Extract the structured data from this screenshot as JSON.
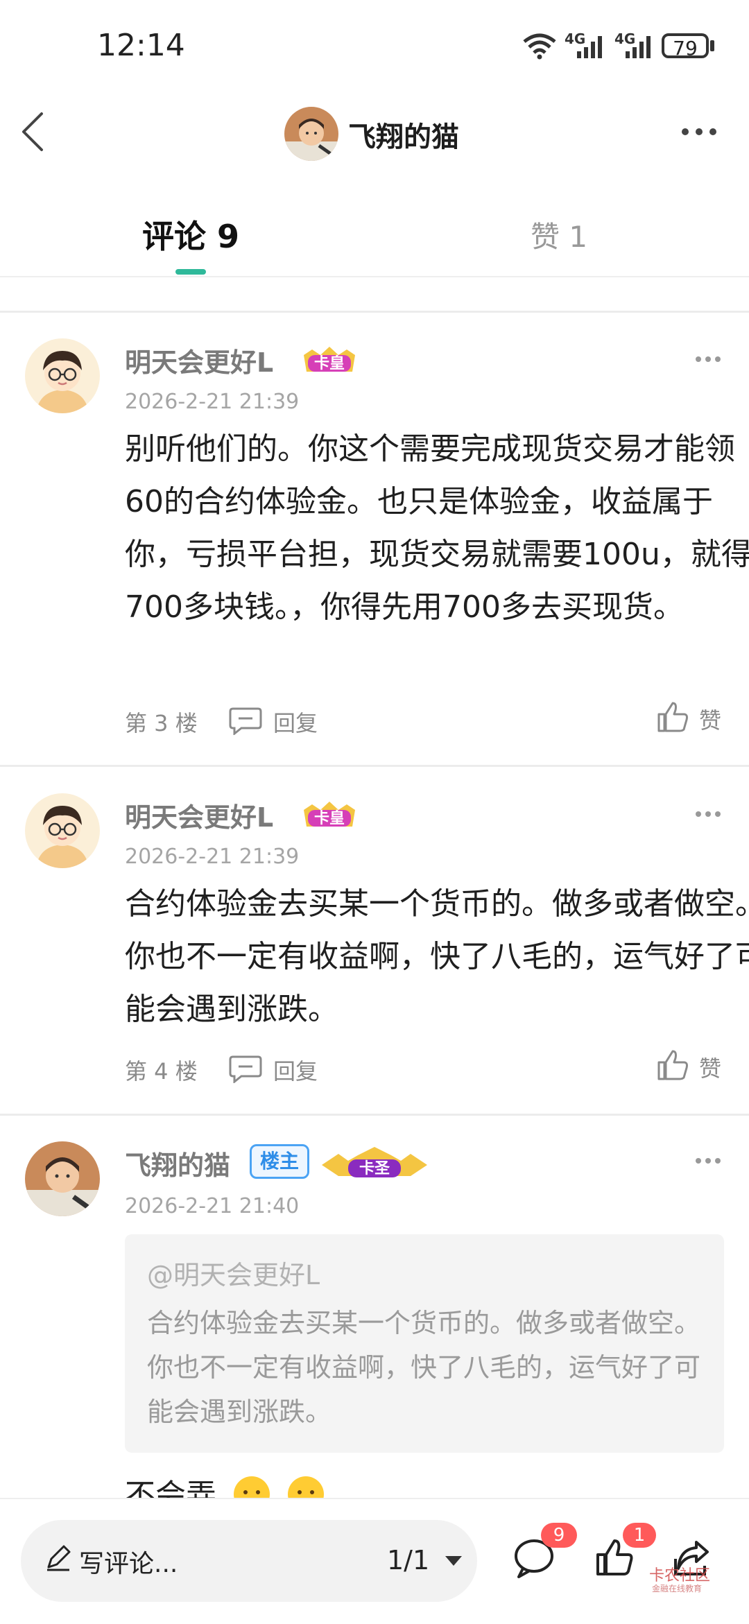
{
  "status_bar": {
    "time": "12:14",
    "battery": "79",
    "network_1": "4G",
    "network_2": "4G"
  },
  "header": {
    "title": "飞翔的猫"
  },
  "tabs": {
    "comments": "评论 9",
    "likes": "赞 1"
  },
  "comments": [
    {
      "username": "明天会更好L",
      "badge": "卡皇",
      "time": "2026-2-21 21:39",
      "text": "别听他们的。你这个需要完成现货交易才能领60的合约体验金。也只是体验金，收益属于你，亏损平台担，现货交易就需要100u，就得700多块钱。，你得先用700多去买现货。",
      "floor": "第 3 楼",
      "reply": "回复",
      "like": "赞"
    },
    {
      "username": "明天会更好L",
      "badge": "卡皇",
      "time": "2026-2-21 21:39",
      "text": "合约体验金去买某一个货币的。做多或者做空。你也不一定有收益啊，快了八毛的，运气好了可能会遇到涨跌。",
      "floor": "第 4 楼",
      "reply": "回复",
      "like": "赞"
    },
    {
      "username": "飞翔的猫",
      "owner_tag": "楼主",
      "badge": "卡圣",
      "time": "2026-2-21 21:40",
      "quote_mention": "@明天会更好L",
      "quote_text": "合约体验金去买某一个货币的。做多或者做空。你也不一定有收益啊，快了八毛的，运气好了可能会遇到涨跌。",
      "text": "不会弄"
    }
  ],
  "bottom_bar": {
    "write_placeholder": "写评论...",
    "page_indicator": "1/1",
    "comment_count": "9",
    "like_count": "1",
    "watermark": "卡农社区",
    "watermark_sub": "金融在线教育"
  },
  "icons": [
    "back-icon",
    "more-icon",
    "wifi-icon",
    "signal-icon",
    "battery-icon",
    "pen-icon",
    "comment-icon",
    "like-icon",
    "share-icon",
    "reply-icon",
    "thumb-icon"
  ],
  "colors": {
    "accent": "#2fb99a",
    "badge_red": "#ff5a5a",
    "owner_blue": "#2e8de8"
  }
}
